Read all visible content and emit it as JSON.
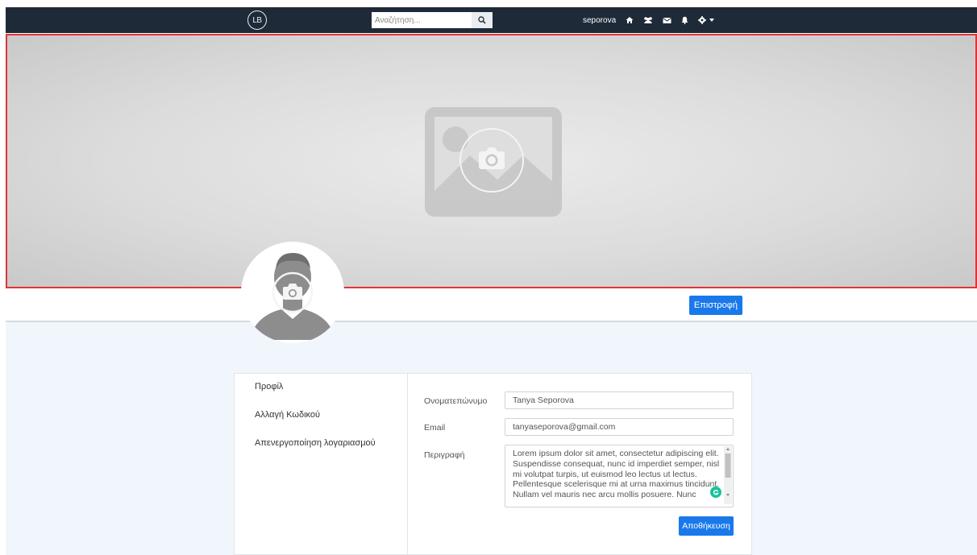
{
  "navbar": {
    "logo_text": "LB",
    "search_placeholder": "Αναζήτηση...",
    "username": "seporova",
    "icons": [
      "home-icon",
      "users-icon",
      "envelope-icon",
      "bell-icon",
      "gear-icon",
      "caret-down-icon"
    ]
  },
  "profile": {
    "return_label": "Επιστροφή"
  },
  "settings_menu": {
    "items": [
      "Προφίλ",
      "Αλλαγή Κωδικού",
      "Απενεργοποίηση λογαριασμού"
    ]
  },
  "form": {
    "fullname_label": "Ονοματεπώνυμο",
    "fullname_value": "Tanya Seporova",
    "email_label": "Email",
    "email_value": "tanyaseporova@gmail.com",
    "description_label": "Περιγραφή",
    "description_value": "Lorem ipsum dolor sit amet, consectetur adipiscing elit. Suspendisse consequat, nunc id imperdiet semper, nisl mi volutpat turpis, ut euismod leo lectus ut lectus. Pellentesque scelerisque mi at urna maximus tincidunt. Nullam vel mauris nec arcu mollis posuere. Nunc",
    "save_label": "Αποθήκευση"
  },
  "colors": {
    "navbar_bg": "#1e2a38",
    "primary_button": "#1a79ea",
    "cover_border": "#e03434",
    "lower_bg": "#f1f6fc"
  }
}
